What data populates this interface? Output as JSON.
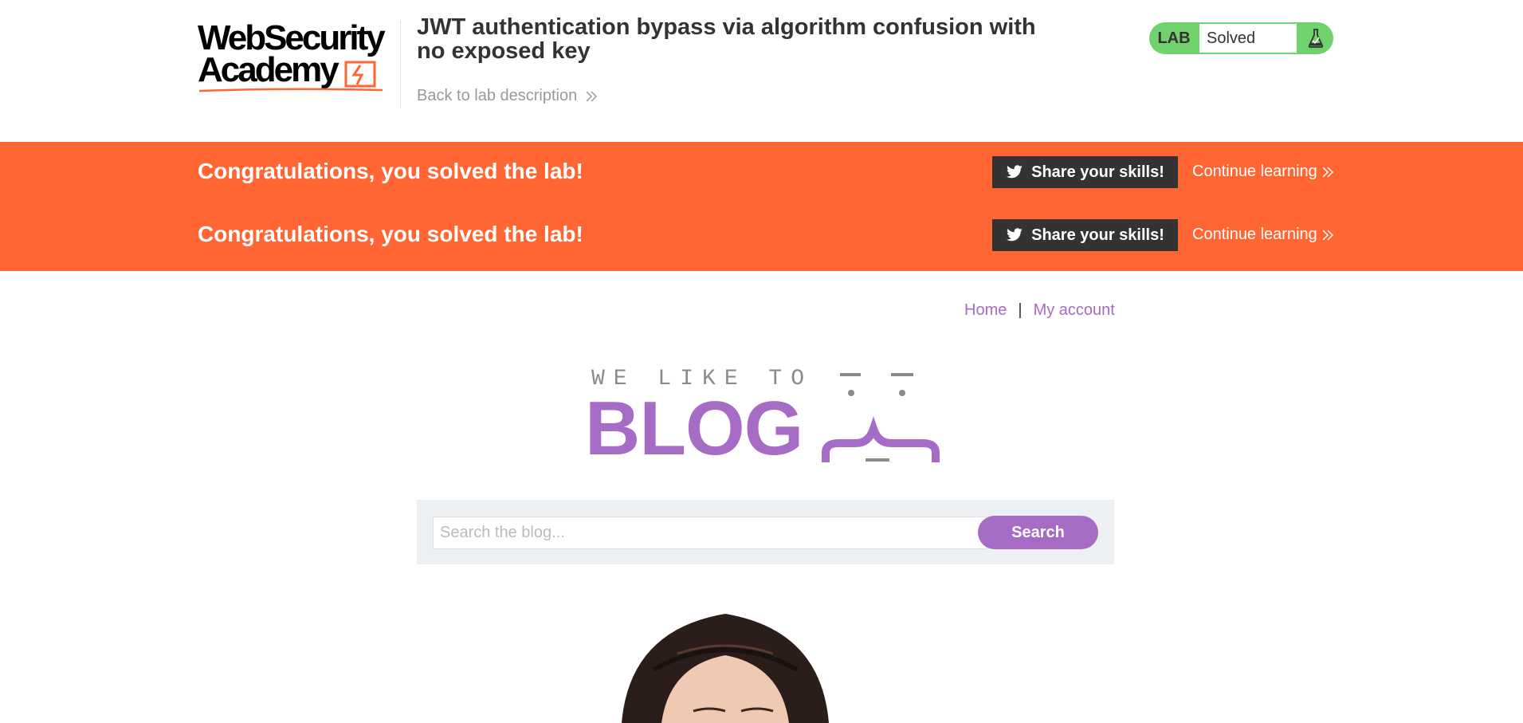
{
  "header": {
    "logo_line1": "WebSecurity",
    "logo_line2": "Academy",
    "lab_title": "JWT authentication bypass via algorithm confusion with no exposed key",
    "back_link": "Back to lab description",
    "status_label": "LAB",
    "status_value": "Solved",
    "status_color": "#70d16d"
  },
  "banner": {
    "color": "#ff6633",
    "rows": [
      {
        "message": "Congratulations, you solved the lab!",
        "share_label": "Share your skills!",
        "continue_label": "Continue learning"
      },
      {
        "message": "Congratulations, you solved the lab!",
        "share_label": "Share your skills!",
        "continue_label": "Continue learning"
      }
    ]
  },
  "nav": {
    "home": "Home",
    "separator": "|",
    "account": "My account"
  },
  "blog_logo": {
    "tagline": "WE LIKE TO",
    "word": "BLOG",
    "accent": "#a56bc5"
  },
  "search": {
    "placeholder": "Search the blog...",
    "button": "Search"
  },
  "icons": [
    "chevron-double-right-icon",
    "flask-icon",
    "twitter-bird-icon"
  ]
}
